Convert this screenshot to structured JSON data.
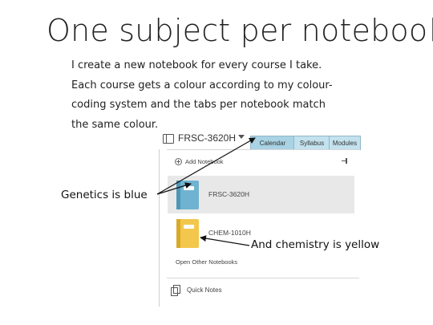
{
  "slide": {
    "title": "One subject per notebook",
    "body_lines": [
      "I create a new notebook for every course I take.",
      "Each course gets a colour according to my colour-",
      "coding system and the tabs per notebook match",
      "the same colour."
    ]
  },
  "onenote": {
    "current_notebook": "FRSC-3620H",
    "tabs": [
      {
        "label": "Calendar",
        "color": "#a9d3e4"
      },
      {
        "label": "Syllabus",
        "color": "#c3e2ee"
      },
      {
        "label": "Modules",
        "color": "#c3e2ee"
      }
    ],
    "add_notebook_label": "Add Notebook",
    "notebooks": [
      {
        "label": "FRSC-3620H",
        "color": "#6fb3d0",
        "selected": true,
        "icon": "notebook-icon"
      },
      {
        "label": "CHEM-1010H",
        "color": "#f2c74c",
        "selected": false,
        "icon": "notebook-icon"
      }
    ],
    "open_other_label": "Open Other Notebooks",
    "quick_notes_label": "Quick Notes"
  },
  "callouts": {
    "genetics": "Genetics is blue",
    "chemistry": "And chemistry is yellow"
  }
}
